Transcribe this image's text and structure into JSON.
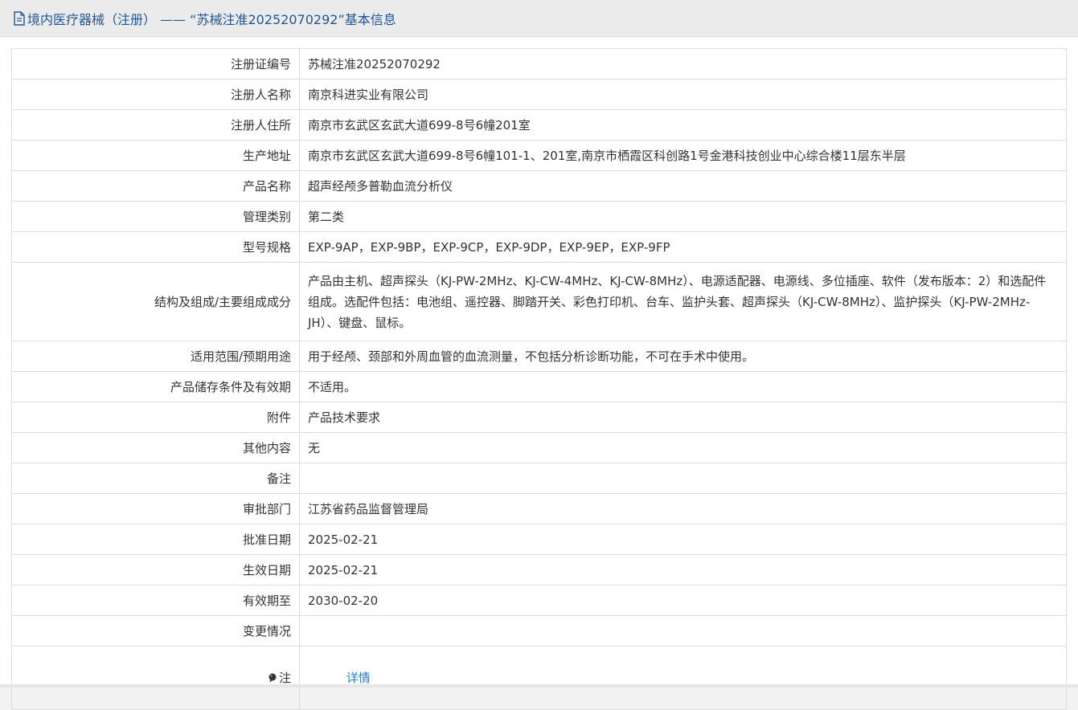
{
  "header": {
    "title": "境内医疗器械（注册） —— “苏械注准20252070292”基本信息",
    "icon": "document-icon"
  },
  "rows": [
    {
      "label": "注册证编号",
      "value": "苏械注准20252070292"
    },
    {
      "label": "注册人名称",
      "value": "南京科进实业有限公司"
    },
    {
      "label": "注册人住所",
      "value": "南京市玄武区玄武大道699-8号6幢201室"
    },
    {
      "label": "生产地址",
      "value": "南京市玄武区玄武大道699-8号6幢101-1、201室,南京市栖霞区科创路1号金港科技创业中心综合楼11层东半层"
    },
    {
      "label": "产品名称",
      "value": "超声经颅多普勒血流分析仪"
    },
    {
      "label": "管理类别",
      "value": "第二类"
    },
    {
      "label": "型号规格",
      "value": "EXP-9AP，EXP-9BP，EXP-9CP，EXP-9DP，EXP-9EP，EXP-9FP"
    },
    {
      "label": "结构及组成/主要组成成分",
      "value": "产品由主机、超声探头（KJ-PW-2MHz、KJ-CW-4MHz、KJ-CW-8MHz）、电源适配器、电源线、多位插座、软件（发布版本：2）和选配件组成。选配件包括：电池组、遥控器、脚踏开关、彩色打印机、台车、监护头套、超声探头（KJ-CW-8MHz）、监护探头（KJ-PW-2MHz-JH）、键盘、鼠标。"
    },
    {
      "label": "适用范围/预期用途",
      "value": "用于经颅、颈部和外周血管的血流测量，不包括分析诊断功能，不可在手术中使用。"
    },
    {
      "label": "产品储存条件及有效期",
      "value": "不适用。"
    },
    {
      "label": "附件",
      "value": "产品技术要求"
    },
    {
      "label": "其他内容",
      "value": "无"
    },
    {
      "label": "备注",
      "value": ""
    },
    {
      "label": "审批部门",
      "value": "江苏省药品监督管理局"
    },
    {
      "label": "批准日期",
      "value": "2025-02-21"
    },
    {
      "label": "生效日期",
      "value": "2025-02-21"
    },
    {
      "label": "有效期至",
      "value": "2030-02-20"
    },
    {
      "label": "变更情况",
      "value": ""
    }
  ],
  "note_row": {
    "icon": "pin-icon",
    "label": "注",
    "link_text": "详情"
  },
  "colors": {
    "header_text": "#1e5799",
    "link": "#2a7dc8",
    "border": "#dddddd"
  }
}
